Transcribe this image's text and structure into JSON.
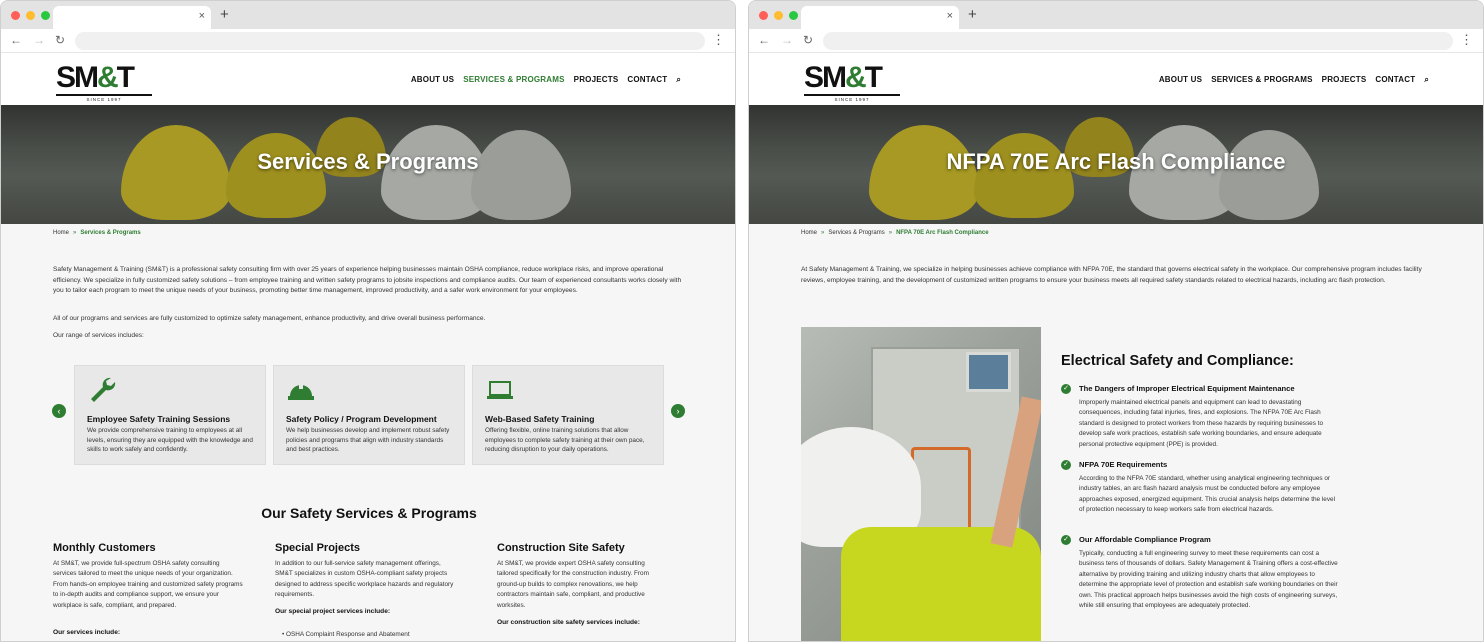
{
  "colors": {
    "brand_green": "#2e7d32",
    "text": "#222222",
    "bg": "#f6f6f6"
  },
  "icons": [
    "back-arrow-icon",
    "forward-arrow-icon",
    "reload-icon",
    "menu-dots-icon",
    "tab-close-icon",
    "new-tab-icon",
    "search-icon",
    "wrench-icon",
    "hard-hat-icon",
    "laptop-icon",
    "check-icon",
    "chevron-left-icon",
    "chevron-right-icon"
  ],
  "browser": {
    "tab_close": "×",
    "new_tab": "+",
    "back": "←",
    "forward": "→",
    "reload": "↻",
    "menu": "⋮"
  },
  "logo": {
    "text_a": "SM",
    "text_amp": "&",
    "text_b": "T",
    "since": "SINCE 1997"
  },
  "nav": {
    "about": "ABOUT US",
    "services": "SERVICES & PROGRAMS",
    "projects": "PROJECTS",
    "contact": "CONTACT",
    "search": "⌕"
  },
  "left": {
    "hero_title": "Services & Programs",
    "breadcrumb": {
      "home": "Home",
      "sep": "»",
      "current": "Services & Programs"
    },
    "intro": "Safety Management & Training (SM&T) is a professional safety consulting firm with over 25 years of experience helping businesses maintain OSHA compliance, reduce workplace risks, and improve operational efficiency. We specialize in fully customized safety solutions – from employee training and written safety programs to jobsite inspections and compliance audits. Our team of experienced consultants works closely with you to tailor each program to meet the unique needs of your business, promoting better time management, improved productivity, and a safer work environment for your employees.",
    "intro2": "All of our programs and services are fully customized to optimize safety management, enhance productivity, and drive overall business performance.",
    "intro3": "Our range of services includes:",
    "cards": [
      {
        "title": "Employee Safety Training Sessions",
        "text": "We provide comprehensive training to employees at all levels, ensuring they are equipped with the knowledge and skills to work safely and confidently."
      },
      {
        "title": "Safety Policy / Program Development",
        "text": "We help businesses develop and implement robust safety policies and programs that align with industry standards and best practices."
      },
      {
        "title": "Web-Based Safety Training",
        "text": "Offering flexible, online training solutions that allow employees to complete safety training at their own pace, reducing disruption to your daily operations."
      }
    ],
    "prev": "‹",
    "next": "›",
    "section_title": "Our Safety Services & Programs",
    "columns": [
      {
        "title": "Monthly Customers",
        "text": "At SM&T, we provide full-spectrum OSHA safety consulting services tailored to meet the unique needs of your organization. From hands-on employee training and customized safety programs to in-depth audits and compliance support, we ensure your workplace is safe, compliant, and prepared.",
        "sub": "Our services include:"
      },
      {
        "title": "Special Projects",
        "text": "In addition to our full-service safety management offerings, SM&T specializes in custom OSHA-compliant safety projects designed to address specific workplace hazards and regulatory requirements.",
        "sub": "Our special project services include:",
        "bullet": "OSHA Complaint Response and Abatement"
      },
      {
        "title": "Construction Site Safety",
        "text": "At SM&T, we provide expert OSHA safety consulting tailored specifically for the construction industry. From ground-up builds to complex renovations, we help contractors maintain safe, compliant, and productive worksites.",
        "sub": "Our construction site safety services include:"
      }
    ]
  },
  "right": {
    "hero_title": "NFPA 70E Arc Flash Compliance",
    "breadcrumb": {
      "home": "Home",
      "sep": "»",
      "mid": "Services & Programs",
      "current": "NFPA 70E Arc Flash Compliance"
    },
    "intro": "At Safety Management & Training, we specialize in helping businesses achieve compliance with NFPA 70E, the standard that governs electrical safety in the workplace. Our comprehensive program includes facility reviews, employee training, and the development of customized written programs to ensure your business meets all required safety standards related to electrical hazards, including arc flash protection.",
    "section_title": "Electrical Safety and Compliance:",
    "items": [
      {
        "title": "The Dangers of Improper Electrical Equipment Maintenance",
        "text": "Improperly maintained electrical panels and equipment can lead to devastating consequences, including fatal injuries, fires, and explosions. The NFPA 70E Arc Flash standard is designed to protect workers from these hazards by requiring businesses to develop safe work practices, establish safe working boundaries, and ensure adequate personal protective equipment (PPE) is provided."
      },
      {
        "title": "NFPA 70E Requirements",
        "text": "According to the NFPA 70E standard, whether using analytical engineering techniques or industry tables, an arc flash hazard analysis must be conducted before any employee approaches exposed, energized equipment. This crucial analysis helps determine the level of protection necessary to keep workers safe from electrical hazards."
      },
      {
        "title": "Our Affordable Compliance Program",
        "text": "Typically, conducting a full engineering survey to meet these requirements can cost a business tens of thousands of dollars. Safety Management & Training offers a cost-effective alternative by providing training and utilizing industry charts that allow employees to determine the appropriate level of protection and establish safe working boundaries on their own. This practical approach helps businesses avoid the high costs of engineering surveys, while still ensuring that employees are adequately protected."
      }
    ],
    "check": "✓"
  }
}
